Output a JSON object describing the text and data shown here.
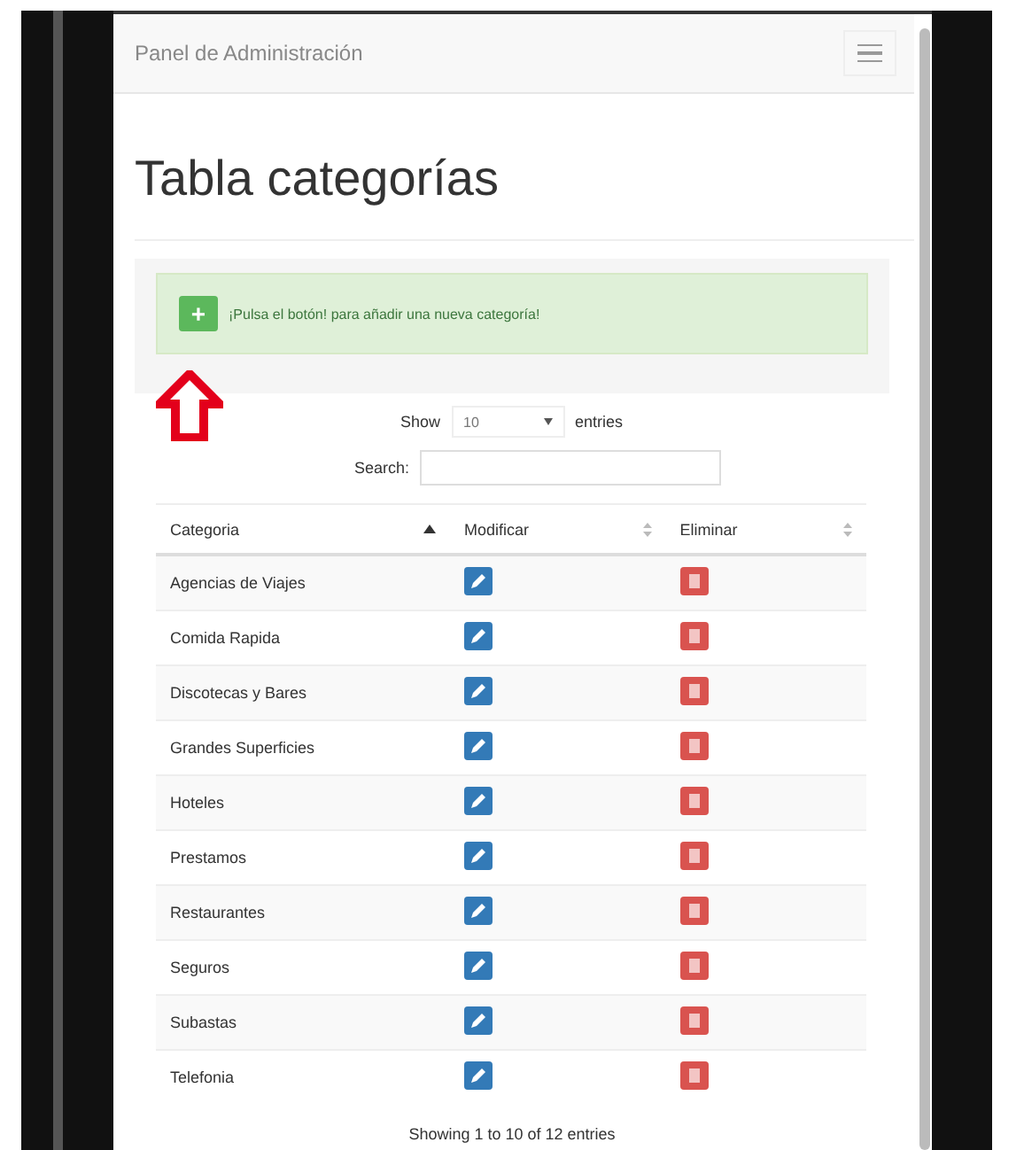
{
  "navbar": {
    "brand": "Panel de Administración"
  },
  "page": {
    "title": "Tabla categorías"
  },
  "alert": {
    "button": "+",
    "text": "¡Pulsa el botón! para añadir una nueva categoría!"
  },
  "length_menu": {
    "label_before": "Show",
    "value": "10",
    "label_after": "entries"
  },
  "search": {
    "label": "Search:"
  },
  "table": {
    "columns": [
      {
        "label": "Categoria",
        "sorted": true
      },
      {
        "label": "Modificar",
        "sorted": false
      },
      {
        "label": "Eliminar",
        "sorted": false
      }
    ],
    "rows": [
      {
        "name": "Agencias de Viajes"
      },
      {
        "name": "Comida Rapida"
      },
      {
        "name": "Discotecas y Bares"
      },
      {
        "name": "Grandes Superficies"
      },
      {
        "name": "Hoteles"
      },
      {
        "name": "Prestamos"
      },
      {
        "name": "Restaurantes"
      },
      {
        "name": "Seguros"
      },
      {
        "name": "Subastas"
      },
      {
        "name": "Telefonia"
      }
    ]
  },
  "info": "Showing 1 to 10 of 12 entries"
}
